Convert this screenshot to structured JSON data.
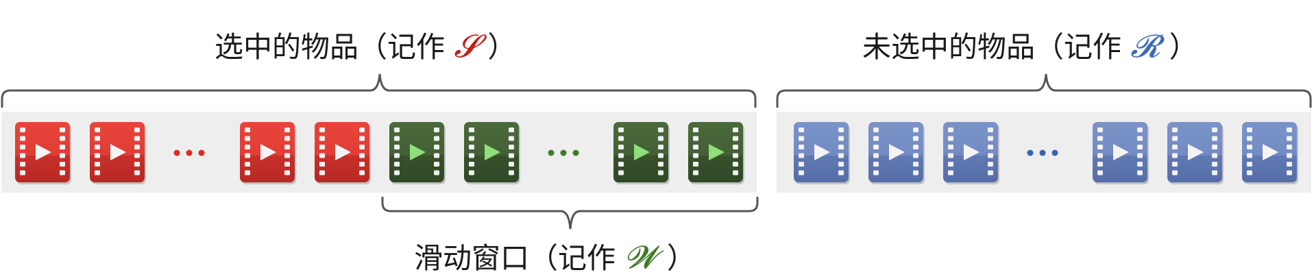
{
  "labels": {
    "selected": {
      "prefix": "选中的物品（记作 ",
      "symbol": "𝓢",
      "suffix": " ）"
    },
    "unselected": {
      "prefix": "未选中的物品（记作 ",
      "symbol": "𝓡",
      "suffix": " ）"
    },
    "window": {
      "prefix": "滑动窗口（记作 ",
      "symbol": "𝓦",
      "suffix": " ）"
    }
  },
  "colors": {
    "selected_tile": "#dc3a33",
    "selected_symbol": "#c0201b",
    "window_tile": "#3d5c30",
    "window_play": "#8fe07a",
    "window_symbol": "#3f7a25",
    "unselected_tile": "#6c86bf",
    "unselected_symbol": "#3e6bb3",
    "strip_bg": "#eeeeee",
    "brace": "#555555",
    "red_dots": "#e02a22",
    "green_dots": "#3c7d2a",
    "blue_dots": "#3a62b3"
  },
  "icons": {
    "tile": "video-film-icon",
    "ellipsis": "ellipsis-icon"
  }
}
